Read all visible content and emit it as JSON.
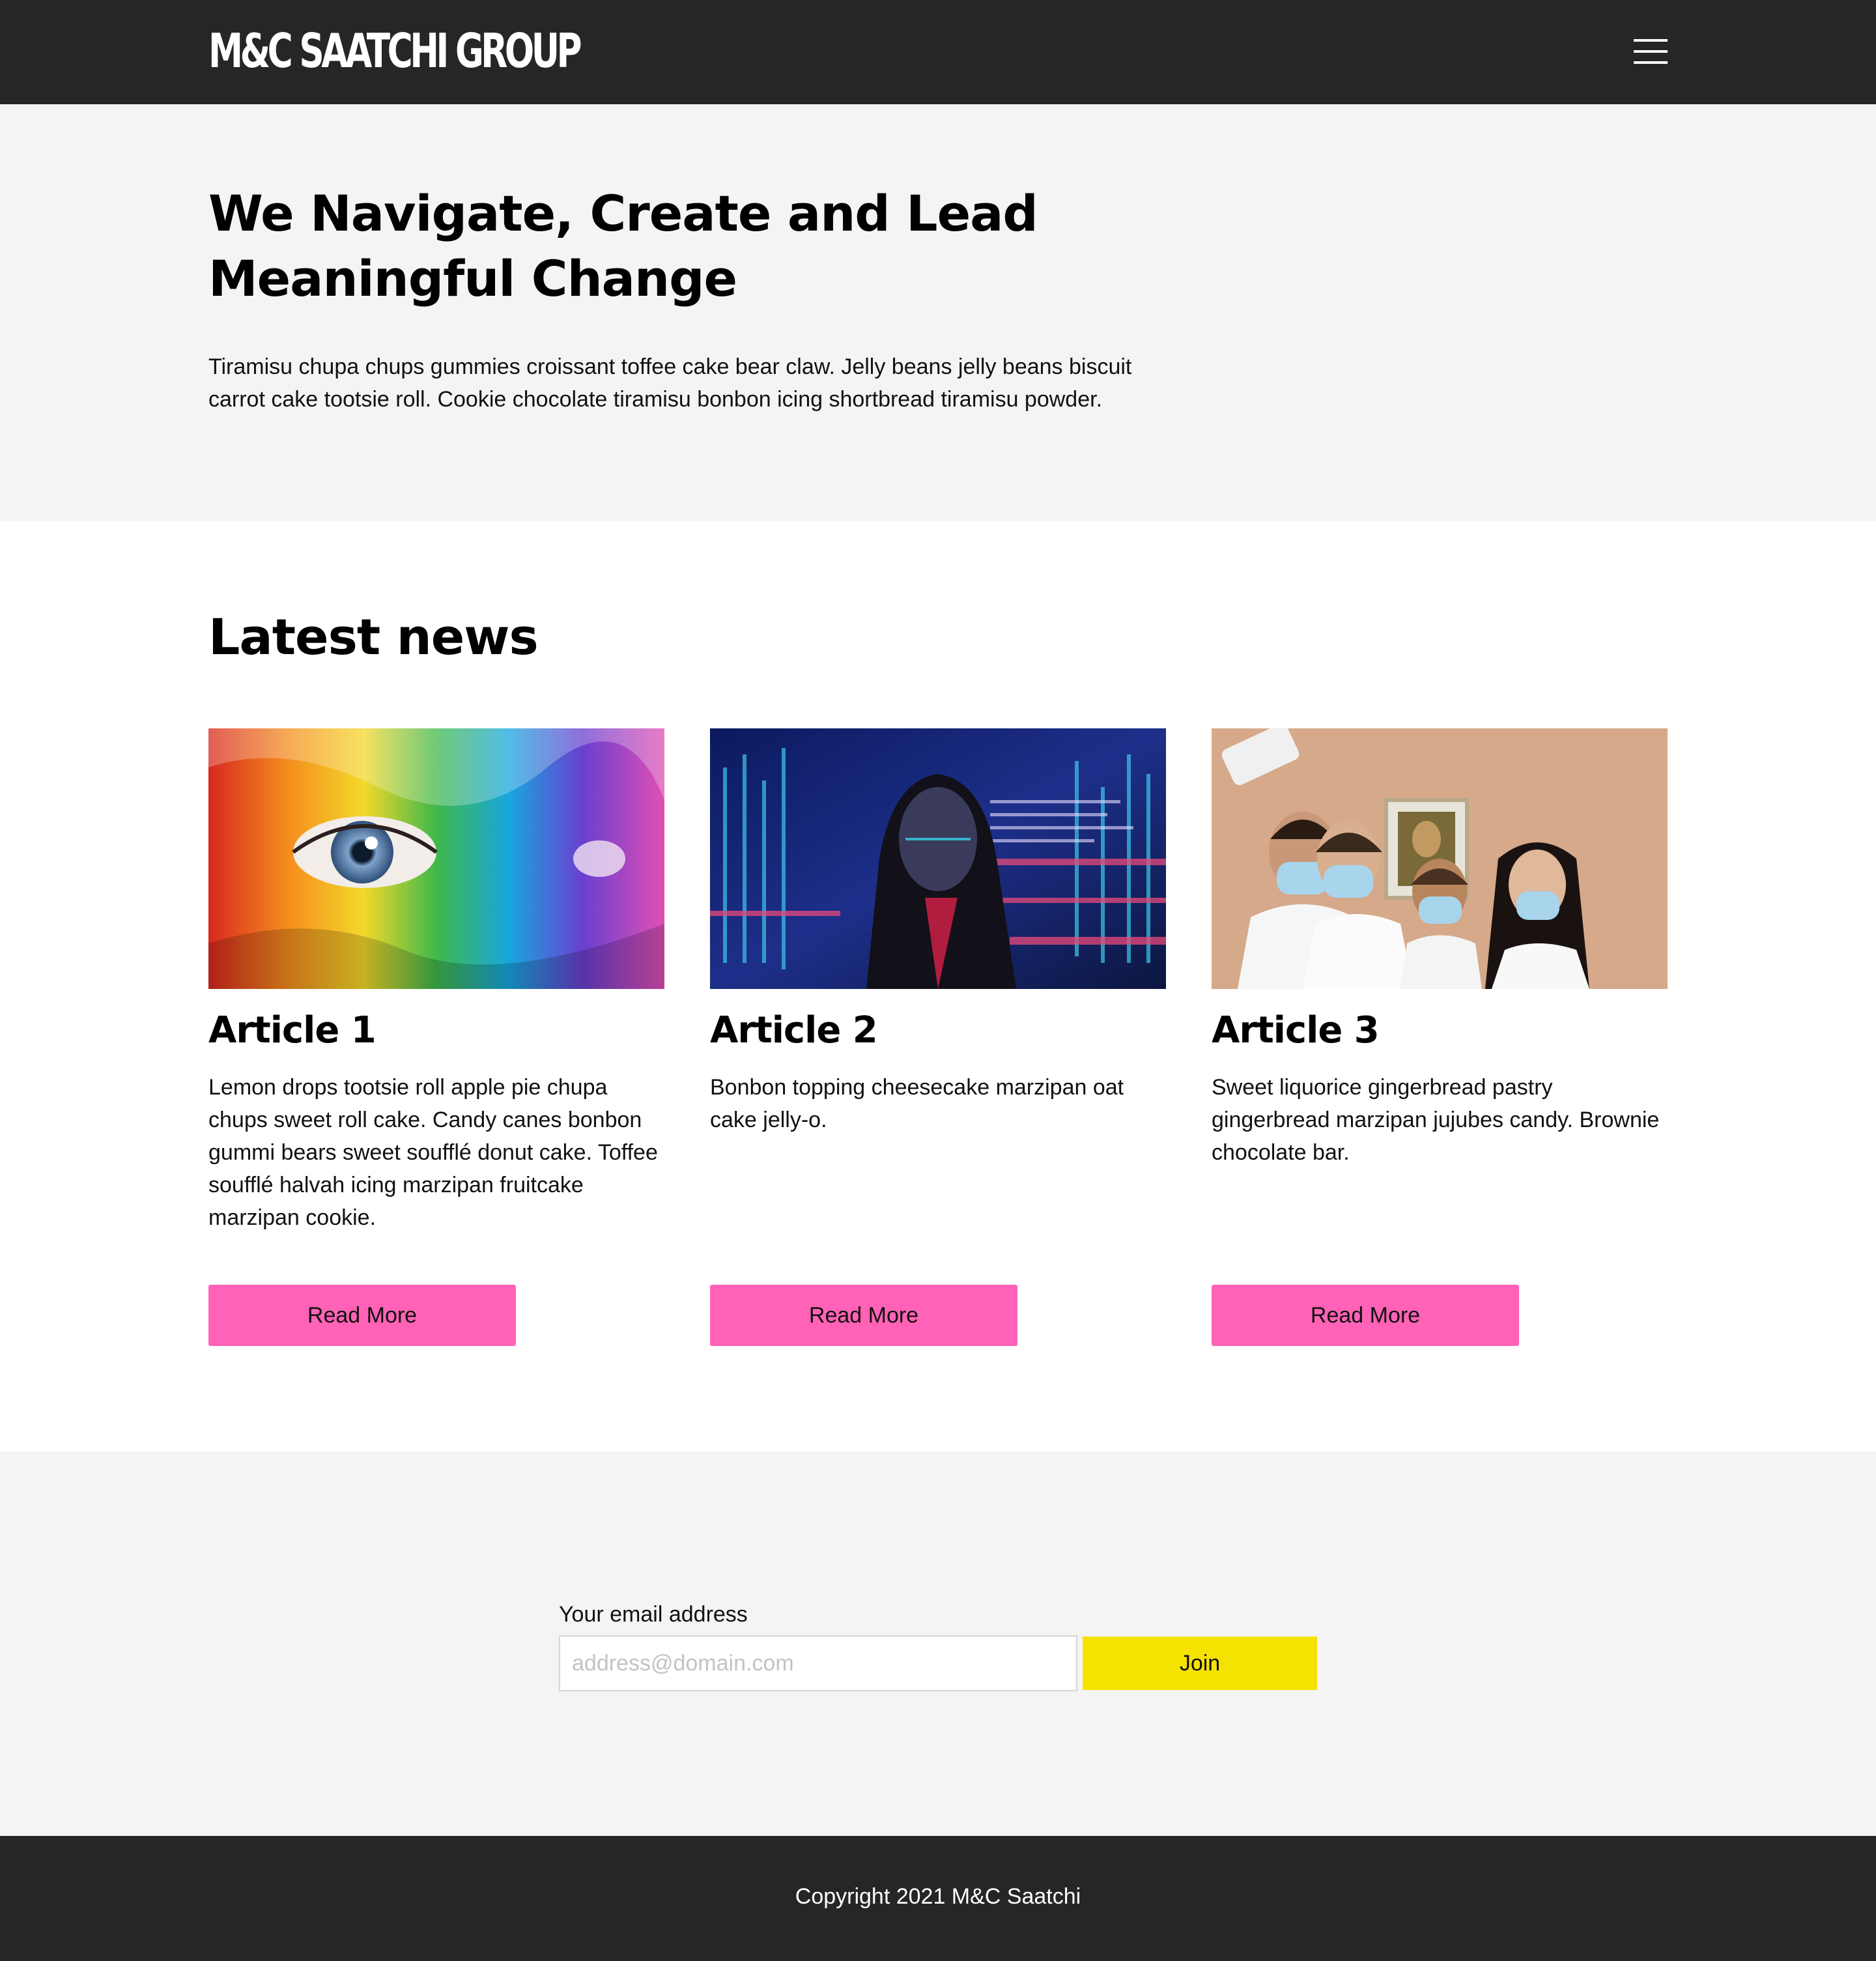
{
  "header": {
    "logo_text": "M&C SAATCHI GROUP",
    "menu_icon": "hamburger-menu-icon"
  },
  "hero": {
    "title": "We Navigate, Create and Lead Meaningful Change",
    "body": "Tiramisu chupa chups gummies croissant toffee cake bear claw. Jelly beans jelly beans biscuit carrot cake tootsie roll. Cookie chocolate tiramisu bonbon icing shortbread tiramisu powder."
  },
  "news": {
    "title": "Latest news",
    "articles": [
      {
        "title": "Article 1",
        "text": "Lemon drops tootsie roll apple pie chupa chups sweet roll cake. Candy canes bonbon gummi bears sweet soufflé donut cake. Toffee soufflé halvah icing marzipan fruitcake marzipan cookie.",
        "button_label": "Read More"
      },
      {
        "title": "Article 2",
        "text": "Bonbon topping cheesecake marzipan oat cake jelly-o.",
        "button_label": "Read More"
      },
      {
        "title": "Article 3",
        "text": "Sweet liquorice gingerbread pastry gingerbread marzipan jujubes candy. Brownie chocolate bar.",
        "button_label": "Read More"
      }
    ]
  },
  "newsletter": {
    "label": "Your email address",
    "placeholder": "address@domain.com",
    "value": "",
    "button_label": "Join"
  },
  "footer": {
    "copyright": "Copyright 2021 M&C Saatchi"
  },
  "colors": {
    "header_bg": "#262626",
    "hero_bg": "#f4f4f4",
    "read_more_bg": "#ff62b6",
    "join_bg": "#f4e200",
    "footer_bg": "#262626"
  }
}
